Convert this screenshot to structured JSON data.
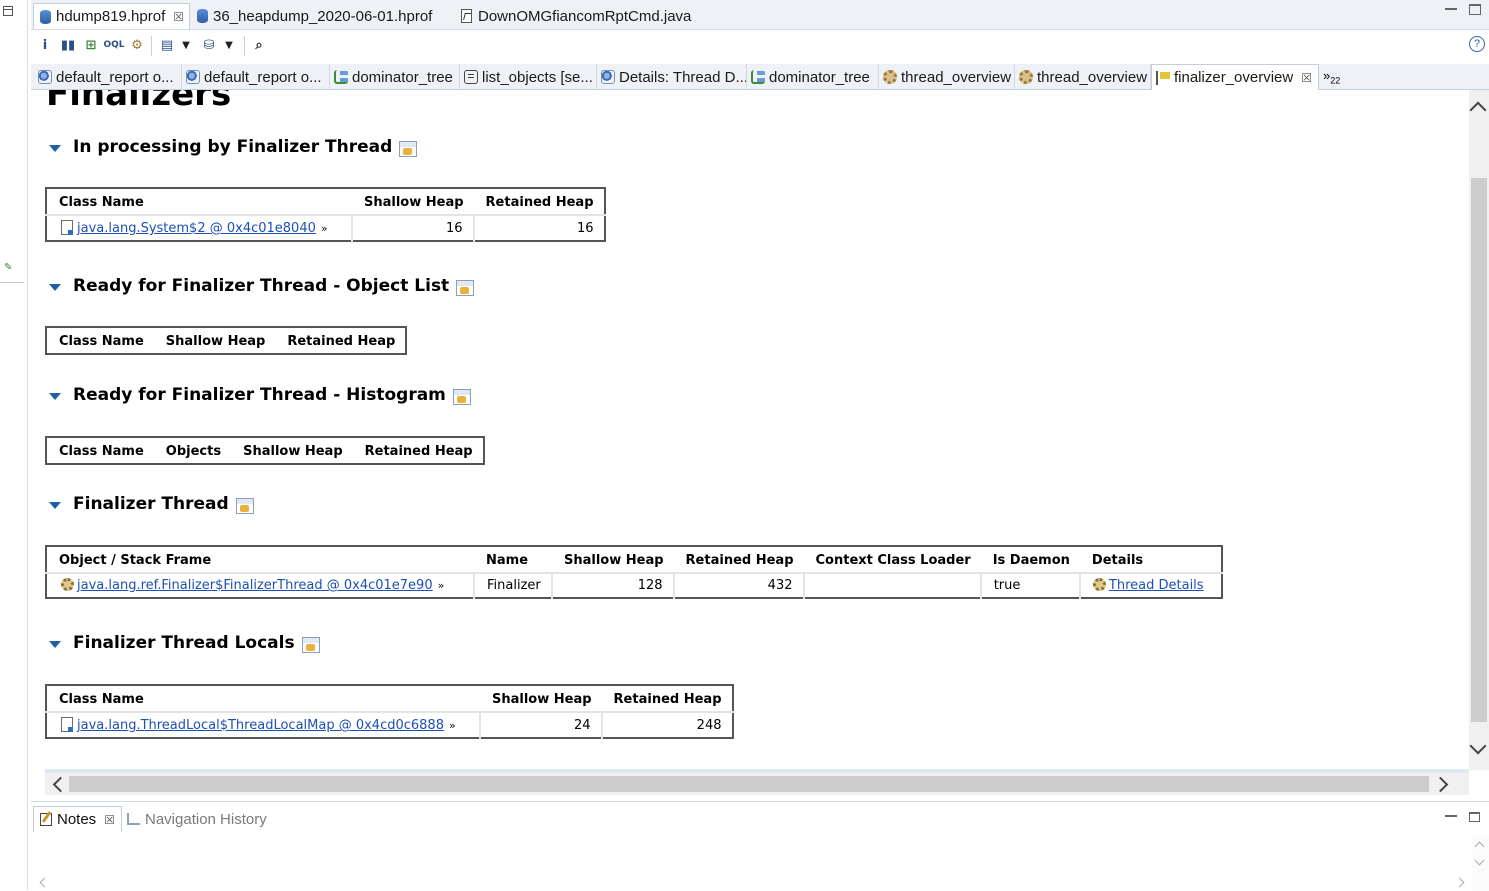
{
  "file_tabs": [
    {
      "label": "hdump819.hprof",
      "close": "☒",
      "icon": "heapdump-icon"
    },
    {
      "label": "36_heapdump_2020-06-01.hprof",
      "icon": "heapdump-icon"
    },
    {
      "label": "DownOMGfiancomRptCmd.java",
      "icon": "java-file-icon"
    }
  ],
  "toolbar": {
    "help": "?"
  },
  "view_tabs": [
    {
      "label": "default_report  o...",
      "icon": "report"
    },
    {
      "label": "default_report  o...",
      "icon": "report"
    },
    {
      "label": "dominator_tree",
      "icon": "tree"
    },
    {
      "label": "list_objects  [se...",
      "icon": "list"
    },
    {
      "label": "Details: Thread D...",
      "icon": "report"
    },
    {
      "label": "dominator_tree",
      "icon": "tree"
    },
    {
      "label": "thread_overview",
      "icon": "gear"
    },
    {
      "label": "thread_overview",
      "icon": "gear"
    },
    {
      "label": "finalizer_overview",
      "icon": "flag",
      "close": "☒"
    }
  ],
  "view_tabs_more": {
    "symbol": "»",
    "count": "22"
  },
  "page_title": "Finalizers",
  "sections": {
    "processing": {
      "title": "In processing by Finalizer Thread",
      "columns": [
        "Class Name",
        "Shallow Heap",
        "Retained Heap"
      ],
      "row": {
        "object": "java.lang.System$2 @ 0x4c01e8040",
        "more": "»",
        "shallow": "16",
        "retained": "16"
      }
    },
    "ready_list": {
      "title": "Ready for Finalizer Thread - Object List",
      "columns": [
        "Class Name",
        "Shallow Heap",
        "Retained Heap"
      ]
    },
    "ready_histogram": {
      "title": "Ready for Finalizer Thread - Histogram",
      "columns": [
        "Class Name",
        "Objects",
        "Shallow Heap",
        "Retained Heap"
      ]
    },
    "finalizer_thread": {
      "title": "Finalizer Thread",
      "columns": [
        "Object / Stack Frame",
        "Name",
        "Shallow Heap",
        "Retained Heap",
        "Context Class Loader",
        "Is Daemon",
        "Details"
      ],
      "row": {
        "object": "java.lang.ref.Finalizer$FinalizerThread @ 0x4c01e7e90",
        "more": "»",
        "name": "Finalizer",
        "shallow": "128",
        "retained": "432",
        "loader": "",
        "daemon": "true",
        "details": "Thread Details"
      }
    },
    "thread_locals": {
      "title": "Finalizer Thread Locals",
      "columns": [
        "Class Name",
        "Shallow Heap",
        "Retained Heap"
      ],
      "row": {
        "object": "java.lang.ThreadLocal$ThreadLocalMap @ 0x4cd0c6888",
        "more": "»",
        "shallow": "24",
        "retained": "248"
      }
    }
  },
  "bottom_panel": {
    "tabs": [
      {
        "label": "Notes",
        "close": "☒"
      },
      {
        "label": "Navigation History"
      }
    ]
  }
}
